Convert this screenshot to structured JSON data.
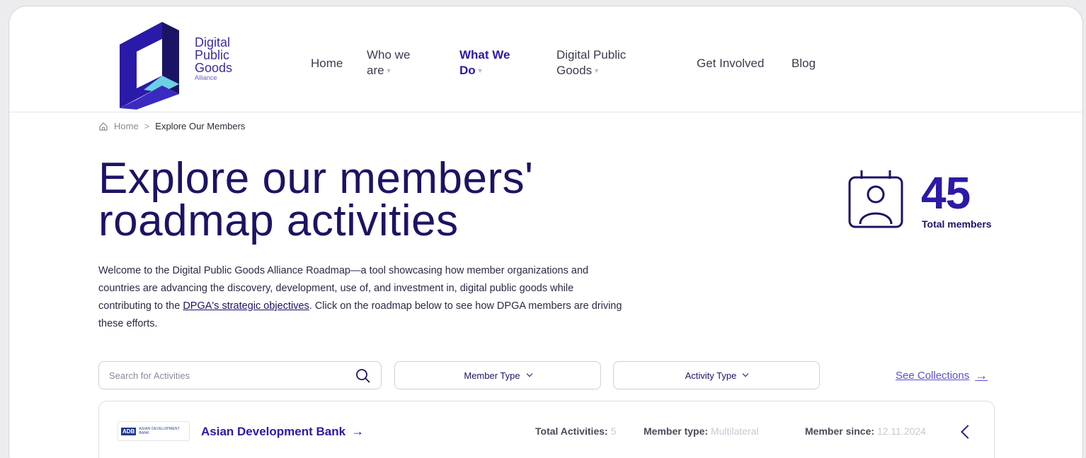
{
  "logo": {
    "line1": "Digital",
    "line2": "Public",
    "line3": "Goods",
    "sub": "Alliance"
  },
  "nav": {
    "items": [
      {
        "label": "Home"
      },
      {
        "label": "Who we are"
      },
      {
        "label": "What We Do"
      },
      {
        "label": "Digital Public Goods"
      },
      {
        "label": "Get Involved"
      },
      {
        "label": "Blog"
      }
    ],
    "who_line1": "Who we",
    "who_line2": "are",
    "what_line1": "What We",
    "what_line2": "Do",
    "dpg_line1": "Digital Public",
    "dpg_line2": "Goods",
    "caret": "▼"
  },
  "breadcrumb": {
    "home": "Home",
    "separator": ">",
    "current": "Explore Our Members"
  },
  "page": {
    "title_line1": "Explore our members'",
    "title_line2": "roadmap activities",
    "intro_before_link": "Welcome to the Digital Public Goods Alliance Roadmap—a tool showcasing how member organizations and countries are advancing the discovery, development, use of, and investment in, digital public goods while contributing to the ",
    "intro_link": "DPGA's strategic objectives",
    "intro_after_link": ". Click on the roadmap below to see how DPGA members are driving these efforts."
  },
  "stats": {
    "total_members_value": "45",
    "total_members_label": "Total members"
  },
  "filters": {
    "search_placeholder": "Search for Activities",
    "member_type_label": "Member Type",
    "activity_type_label": "Activity Type",
    "see_collections": "See Collections",
    "arrow": "→"
  },
  "members": [
    {
      "logo_mark": "ADB",
      "logo_text": "ASIAN DEVELOPMENT BANK",
      "name": "Asian Development Bank",
      "total_activities_label": "Total Activities:",
      "total_activities_value": "5",
      "member_type_label": "Member type:",
      "member_type_value": "Multilateral",
      "member_since_label": "Member since:",
      "member_since_value": "12.11.2024"
    }
  ],
  "colors": {
    "brand_primary": "#2a1aa8",
    "brand_dark": "#1b1464",
    "accent_teal": "#6ad1e3",
    "link": "#5a4fd0"
  }
}
